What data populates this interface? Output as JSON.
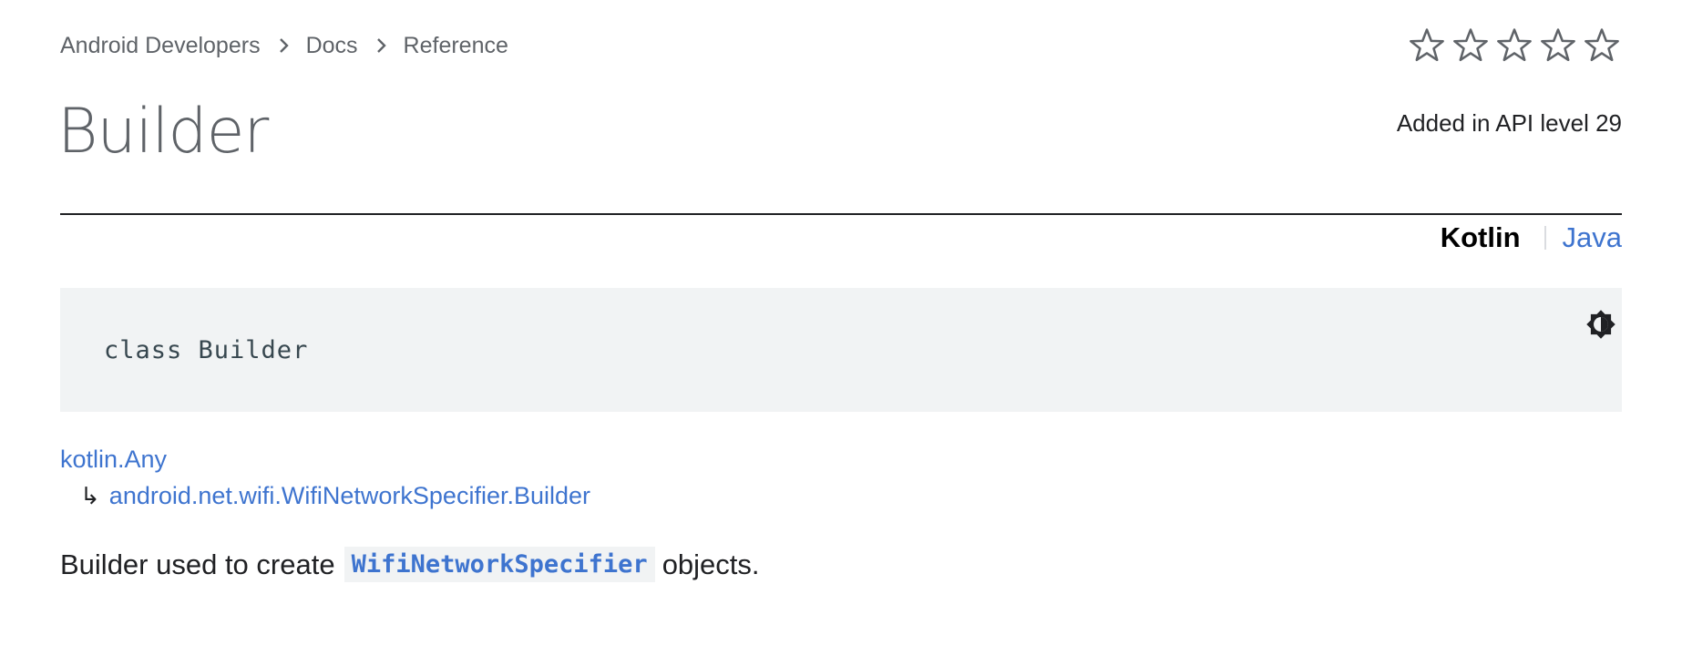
{
  "breadcrumb": {
    "items": [
      "Android Developers",
      "Docs",
      "Reference"
    ]
  },
  "rating": {
    "stars": 5,
    "filled": 0
  },
  "title": "Builder",
  "api_level": "Added in API level 29",
  "language": {
    "active": "Kotlin",
    "other": "Java"
  },
  "code_block": {
    "code": "class Builder"
  },
  "inheritance": {
    "root": "kotlin.Any",
    "arrow": "↳",
    "child": "android.net.wifi.WifiNetworkSpecifier.Builder"
  },
  "description": {
    "prefix": "Builder used to create",
    "link": "WifiNetworkSpecifier",
    "suffix": "objects."
  },
  "colors": {
    "link": "#3e74cf",
    "code_background": "#f1f3f4",
    "muted_text": "#5f6368"
  },
  "icons": {
    "breadcrumb_separator": "chevron-right-icon",
    "rating": "star-outline-icon",
    "theme_toggle": "brightness-icon"
  }
}
